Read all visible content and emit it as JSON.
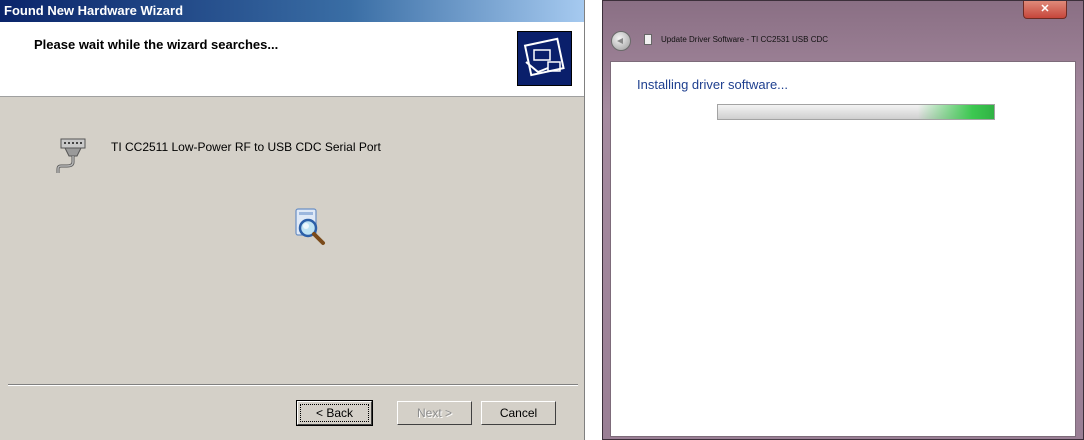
{
  "xp_wizard": {
    "title": "Found New Hardware Wizard",
    "heading": "Please wait while the wizard searches...",
    "device_name": "TI CC2511 Low-Power RF to USB CDC Serial Port",
    "buttons": {
      "back": "< Back",
      "next": "Next >",
      "cancel": "Cancel"
    },
    "icons": [
      "hardware-wizard-icon",
      "serial-port-icon",
      "search-magnifier-icon"
    ]
  },
  "win7_dialog": {
    "title": "Update Driver Software - TI CC2531 USB CDC",
    "status": "Installing driver software...",
    "progress_mode": "indeterminate",
    "icons": [
      "back-arrow-icon",
      "document-icon",
      "close-icon"
    ],
    "colors": {
      "status_text": "#1e3f8f",
      "progress_accent": "#3cc850"
    }
  }
}
